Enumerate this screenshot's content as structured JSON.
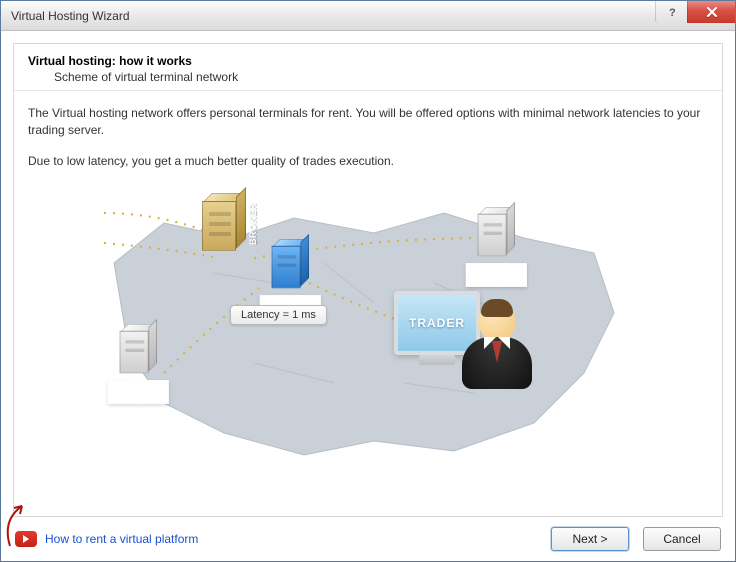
{
  "window": {
    "title": "Virtual Hosting Wizard"
  },
  "header": {
    "title": "Virtual hosting: how it works",
    "subtitle": "Scheme of virtual terminal network"
  },
  "body": {
    "p1": "The Virtual hosting network offers personal terminals for rent. You will be offered options with minimal network latencies to your trading server.",
    "p2": "Due to low latency, you get a much better quality of trades execution."
  },
  "diagram": {
    "broker_label": "BROKER",
    "trader_label": "TRADER",
    "latency_label": "Latency = 1 ms"
  },
  "footer": {
    "link_text": "How to rent a virtual platform",
    "next_label": "Next >",
    "cancel_label": "Cancel"
  }
}
